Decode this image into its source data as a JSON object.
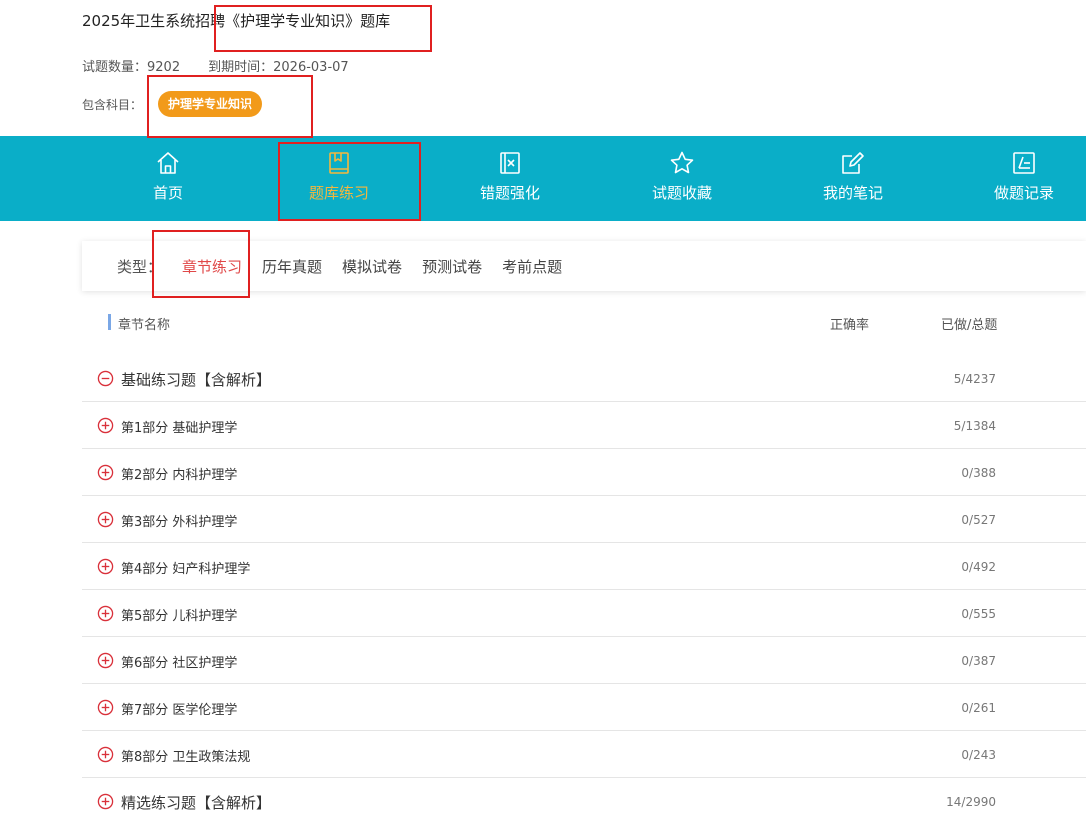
{
  "header": {
    "title": "2025年卫生系统招聘《护理学专业知识》题库",
    "question_count_label": "试题数量：",
    "question_count": "9202",
    "expiry_label": "到期时间：",
    "expiry_date": "2026-03-07",
    "subjects_label": "包含科目：",
    "subject_tag": "护理学专业知识"
  },
  "nav": {
    "items": [
      {
        "label": "首页",
        "icon": "home-icon"
      },
      {
        "label": "题库练习",
        "icon": "book-icon",
        "active": true
      },
      {
        "label": "错题强化",
        "icon": "wrong-question-icon"
      },
      {
        "label": "试题收藏",
        "icon": "star-icon"
      },
      {
        "label": "我的笔记",
        "icon": "note-edit-icon"
      },
      {
        "label": "做题记录",
        "icon": "record-icon"
      }
    ]
  },
  "types": {
    "label": "类型：",
    "items": [
      "章节练习",
      "历年真题",
      "模拟试卷",
      "预测试卷",
      "考前点题"
    ],
    "active": "章节练习"
  },
  "table": {
    "headers": {
      "name": "章节名称",
      "accuracy": "正确率",
      "progress": "已做/总题"
    },
    "rows": [
      {
        "name": "基础练习题【含解析】",
        "progress": "5/4237",
        "level": "top",
        "expanded": true
      },
      {
        "name": "第1部分 基础护理学",
        "progress": "5/1384",
        "level": "sub"
      },
      {
        "name": "第2部分 内科护理学",
        "progress": "0/388",
        "level": "sub"
      },
      {
        "name": "第3部分 外科护理学",
        "progress": "0/527",
        "level": "sub"
      },
      {
        "name": "第4部分 妇产科护理学",
        "progress": "0/492",
        "level": "sub"
      },
      {
        "name": "第5部分 儿科护理学",
        "progress": "0/555",
        "level": "sub"
      },
      {
        "name": "第6部分 社区护理学",
        "progress": "0/387",
        "level": "sub"
      },
      {
        "name": "第7部分 医学伦理学",
        "progress": "0/261",
        "level": "sub"
      },
      {
        "name": "第8部分 卫生政策法规",
        "progress": "0/243",
        "level": "sub"
      },
      {
        "name": "精选练习题【含解析】",
        "progress": "14/2990",
        "level": "top",
        "expanded": false
      }
    ]
  },
  "colors": {
    "nav_bg": "#0aaec8",
    "accent_orange": "#f29a1a",
    "active_nav": "#f6b73c",
    "active_type": "#e04848",
    "expand_icon": "#d9303a",
    "highlight_box": "#e02020"
  }
}
